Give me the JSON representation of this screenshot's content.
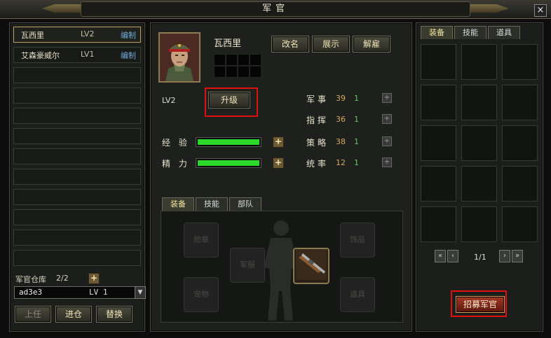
{
  "window": {
    "title": "军官",
    "close": "×"
  },
  "officer_list": [
    {
      "name": "瓦西里",
      "level": "LV2",
      "action": "编制"
    },
    {
      "name": "艾森豪威尔",
      "level": "LV1",
      "action": "编制"
    }
  ],
  "warehouse": {
    "label": "军官仓库",
    "count": "2/2",
    "plus": "+"
  },
  "selector": {
    "value": "ad3e3",
    "level": "LV 1",
    "arrow": "▼"
  },
  "left_buttons": {
    "appoint": "上任",
    "enter": "进仓",
    "replace": "替换"
  },
  "officer": {
    "name": "瓦西里",
    "level": "LV2",
    "rename": "改名",
    "display": "展示",
    "dismiss": "解雇",
    "upgrade": "升级",
    "exp_label": "经 验",
    "energy_label": "精 力",
    "exp_fill": 1.0,
    "energy_fill": 1.0
  },
  "attributes": [
    {
      "name": "军事",
      "value": "39",
      "bonus": "1"
    },
    {
      "name": "指挥",
      "value": "36",
      "bonus": "1"
    },
    {
      "name": "策略",
      "value": "38",
      "bonus": "1"
    },
    {
      "name": "统率",
      "value": "12",
      "bonus": "1"
    }
  ],
  "mid_tabs": [
    "装备",
    "技能",
    "部队"
  ],
  "equip_slots": {
    "medal": "勋章",
    "jewel": "饰品",
    "uniform": "军服",
    "pet": "宠物",
    "tool": "道具"
  },
  "right_tabs": [
    "装备",
    "技能",
    "道具"
  ],
  "pager": {
    "page": "1/1",
    "first": "«",
    "prev": "‹",
    "next": "›",
    "last": "»"
  },
  "recruit": "招募军官",
  "colors": {
    "highlight": "#e01010",
    "bar": "#2dd82d",
    "edit_link": "#6fa8d8"
  }
}
